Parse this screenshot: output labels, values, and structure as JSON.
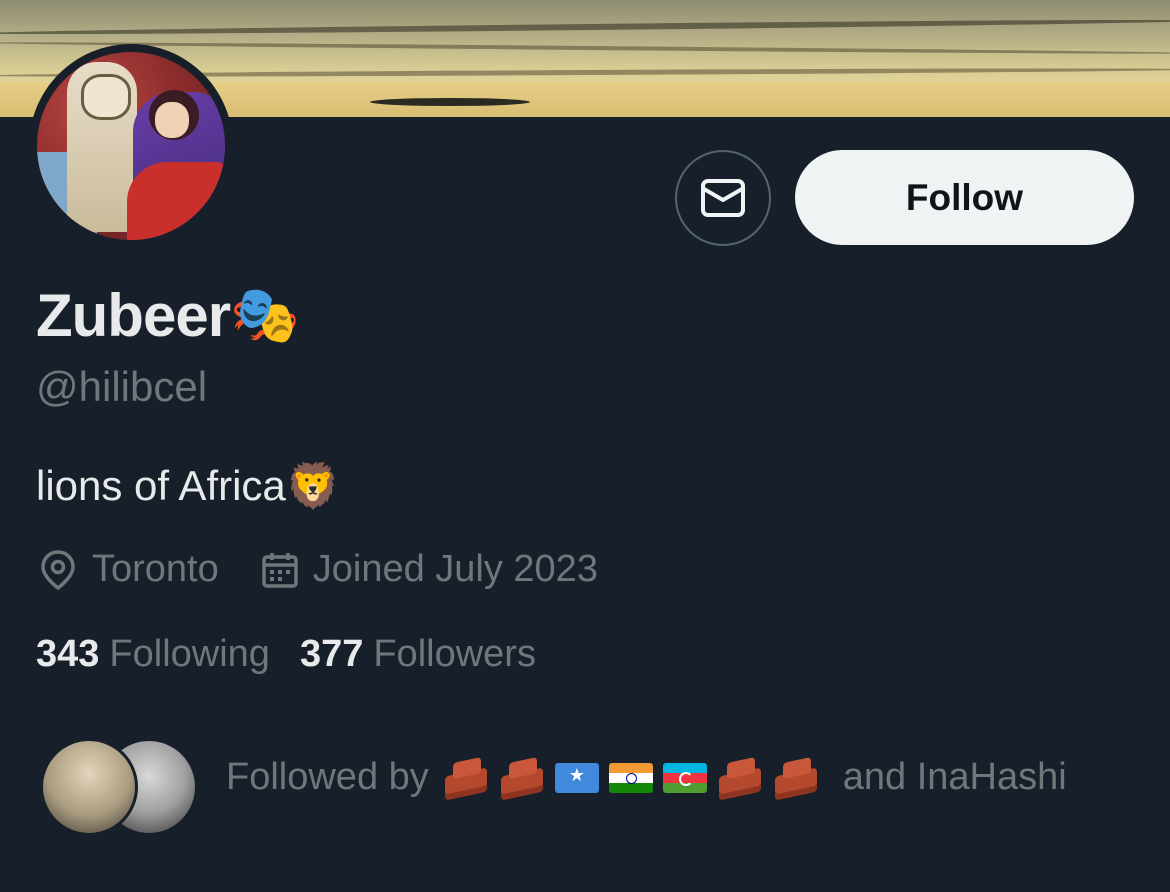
{
  "profile": {
    "name": "Zubeer",
    "name_emoji": "🎭",
    "handle": "@hilibcel",
    "bio": "lions of Africa",
    "bio_emoji": "🦁",
    "location": "Toronto",
    "joined": "Joined July 2023",
    "following_count": "343",
    "following_label": "Following",
    "followers_count": "377",
    "followers_label": "Followers"
  },
  "actions": {
    "message_icon": "envelope-icon",
    "follow_label": "Follow"
  },
  "followed_by": {
    "prefix": "Followed by",
    "suffix": "and InaHashi",
    "emoji_names": [
      "brick",
      "brick",
      "flag-somalia",
      "flag-india",
      "flag-azerbaijan",
      "brick",
      "brick"
    ]
  },
  "colors": {
    "background": "#17202a",
    "primary_text": "#e7e9ea",
    "secondary_text": "#71767b",
    "follow_button": "#eff3f4"
  }
}
